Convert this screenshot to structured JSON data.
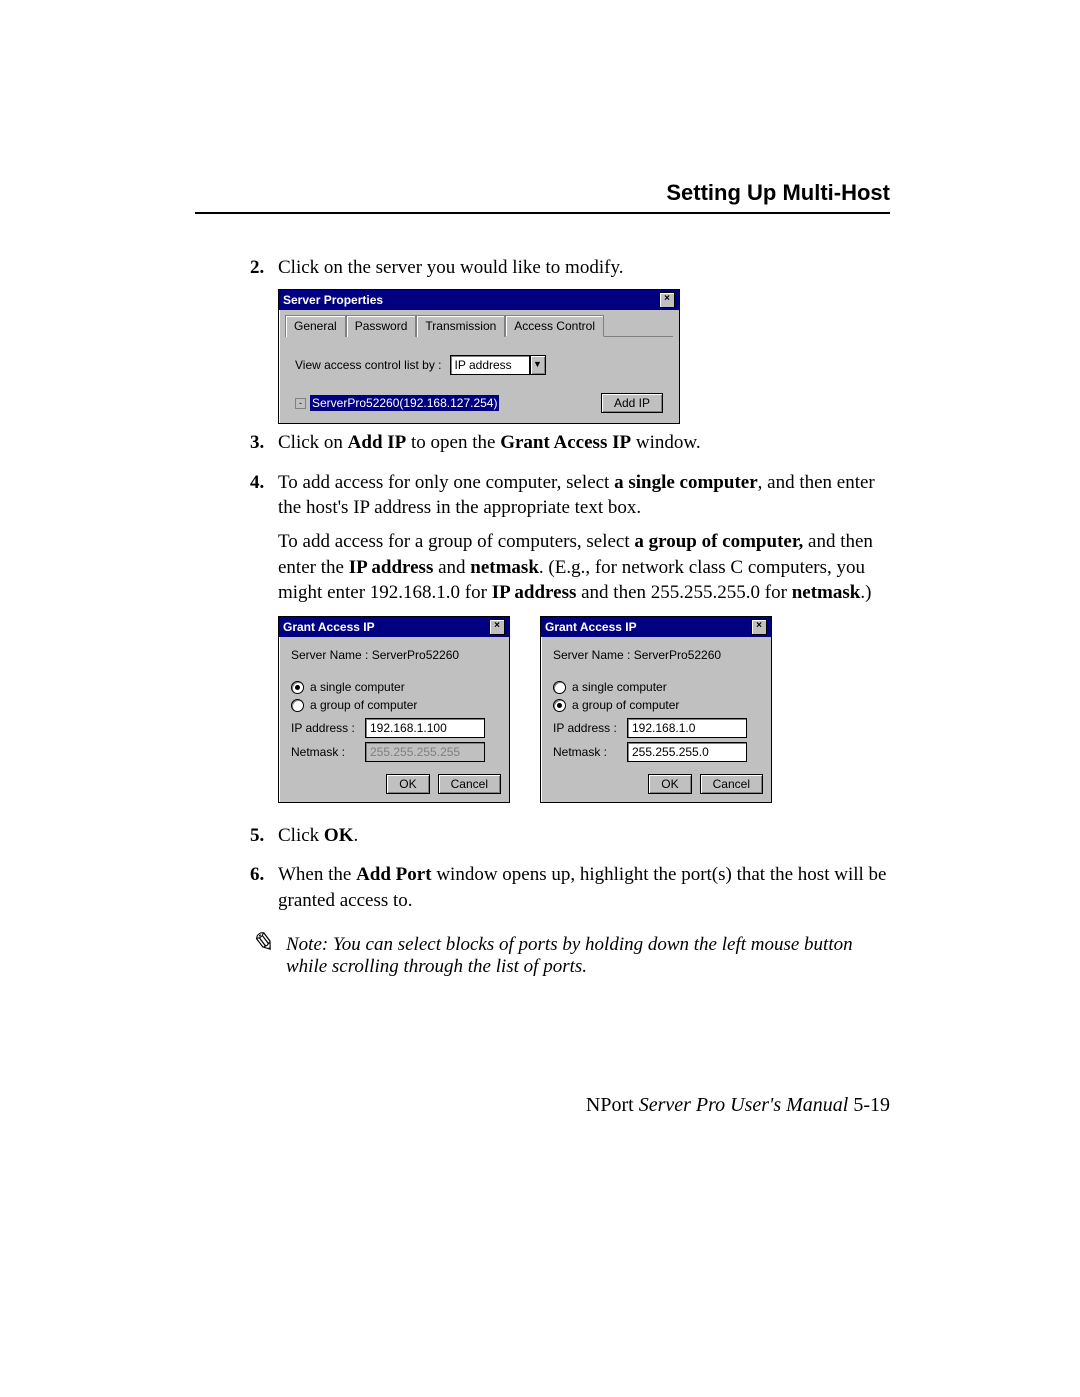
{
  "header": {
    "title": "Setting Up Multi-Host"
  },
  "steps": {
    "s2": {
      "num": "2.",
      "text": "Click on the server you would like to modify."
    },
    "s3": {
      "num": "3.",
      "t1": "Click on ",
      "b1": "Add IP",
      "t2": " to open the ",
      "b2": "Grant Access IP",
      "t3": " window."
    },
    "s4": {
      "num": "4.",
      "p1_t1": "To add access for only one computer, select ",
      "p1_b1": "a single computer",
      "p1_t2": ", and then enter the host's IP address in the appropriate text box.",
      "p2_t1": "To add access for a group of computers, select ",
      "p2_b1": "a group of computer,",
      "p2_t2": " and then enter the ",
      "p2_b2": "IP address",
      "p2_t3": " and ",
      "p2_b3": "netmask",
      "p2_t4": ". (E.g., for network class C computers, you might enter 192.168.1.0 for ",
      "p2_b4": "IP address",
      "p2_t5": " and then 255.255.255.0 for ",
      "p2_b5": "netmask",
      "p2_t6": ".)"
    },
    "s5": {
      "num": "5.",
      "t1": "Click ",
      "b1": "OK",
      "t2": "."
    },
    "s6": {
      "num": "6.",
      "t1": "When the ",
      "b1": "Add Port",
      "t2": " window opens up, highlight the port(s) that the host will be granted access to."
    }
  },
  "note": {
    "text": "Note: You can select blocks of ports by holding down the left mouse button while scrolling through the list of ports."
  },
  "dlg_server_props": {
    "title": "Server Properties",
    "tabs": [
      "General",
      "Password",
      "Transmission",
      "Access Control"
    ],
    "active_tab": 3,
    "label_viewby": "View access control list by :",
    "combo_value": "IP address",
    "tree_selected": "ServerPro52260(192.168.127.254)",
    "btn_addip": "Add IP"
  },
  "dlg_grant_left": {
    "title": "Grant Access IP",
    "server_label": "Server Name : ServerPro52260",
    "opt_single": "a single computer",
    "opt_group": "a group of computer",
    "selected": "single",
    "ip_label": "IP address :",
    "ip_value": "192.168.1.100",
    "mask_label": "Netmask :",
    "mask_value": "255.255.255.255",
    "ok": "OK",
    "cancel": "Cancel"
  },
  "dlg_grant_right": {
    "title": "Grant Access IP",
    "server_label": "Server Name : ServerPro52260",
    "opt_single": "a single computer",
    "opt_group": "a group of computer",
    "selected": "group",
    "ip_label": "IP address :",
    "ip_value": "192.168.1.0",
    "mask_label": "Netmask :",
    "mask_value": "255.255.255.0",
    "ok": "OK",
    "cancel": "Cancel"
  },
  "footer": {
    "product": "NPort ",
    "manual": "Server Pro User's Manual",
    "page": "   5-19"
  }
}
